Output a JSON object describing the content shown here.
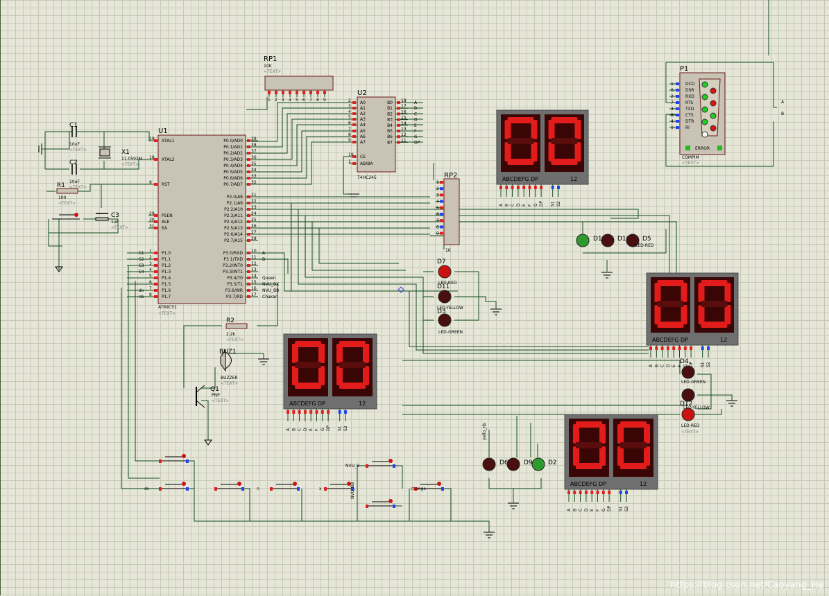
{
  "labels": {
    "u1_ref": "U1",
    "u1_part": "AT89C51",
    "u2_ref": "U2",
    "u2_part": "74HC245",
    "rp1_ref": "RP1",
    "rp1_val": "10K",
    "rp2_ref": "RP2",
    "rp2_val": "1K",
    "p1_ref": "P1",
    "p1_part": "COMPIM",
    "p1_error": "ERROR",
    "c1_ref": "C1",
    "c1_val": "10uF",
    "c2_ref": "C2",
    "c2_val": "10uF",
    "c3_ref": "C3",
    "c3_val": "1uF",
    "x1_ref": "X1",
    "x1_val": "11.0592M",
    "r1_ref": "R1",
    "r1_val": "100",
    "r2_ref": "R2",
    "r2_val": "2.2k",
    "buz_ref": "BUZ1",
    "buz_part": "BUZZER",
    "q1_ref": "Q1",
    "q1_part": "PNP",
    "text_tag": "<TEXT>",
    "disp_pins": "ABCDEFG  DP",
    "disp_digits": "12",
    "u1_xtal1": "XTAL1",
    "u1_xtal2": "XTAL2",
    "u1_rst": "RST",
    "u1_psen": "PSEN",
    "u1_ale": "ALE",
    "u1_ea": "EA",
    "led_red": "LED-RED",
    "led_yellow": "LED-YELLOW",
    "led_green": "LED-GREEN",
    "d1": "D1",
    "d2": "D2",
    "d3": "D3",
    "d4": "D4",
    "d5": "D5",
    "d6": "D6",
    "d7": "D7",
    "d8": "D8",
    "d9": "D9",
    "d10": "D10",
    "d11": "D11",
    "d12": "D12",
    "yello_nb": "yello_nb",
    "sw_sk": "sk",
    "sw_n": "n",
    "sw_x": "x",
    "sw_c": "c",
    "sw_nvu_b": "NVU_B",
    "sw_nvu_bb": "NVU_BB",
    "sw_change": "change",
    "seg_value": "00",
    "watermark": "https://blog.csdn.net/Caoyang_He"
  },
  "u1_left_pins": [
    {
      "num": "19",
      "name": "XTAL1"
    },
    {
      "num": "18",
      "name": "XTAL2"
    },
    {
      "num": "9",
      "name": "RST"
    },
    {
      "num": "29",
      "name": "PSEN"
    },
    {
      "num": "30",
      "name": "ALE"
    },
    {
      "num": "31",
      "name": "EA"
    },
    {
      "num": "1",
      "name": "P1.0"
    },
    {
      "num": "2",
      "name": "P1.1"
    },
    {
      "num": "3",
      "name": "P1.2"
    },
    {
      "num": "4",
      "name": "P1.3"
    },
    {
      "num": "5",
      "name": "P1.4"
    },
    {
      "num": "6",
      "name": "P1.5"
    },
    {
      "num": "7",
      "name": "P1.6"
    },
    {
      "num": "8",
      "name": "P1.7"
    }
  ],
  "u1_p1_nets": [
    "S1",
    "S2",
    "S3",
    "S4",
    "",
    "",
    "dx",
    "nb"
  ],
  "u1_right_pins": [
    {
      "num": "39",
      "name": "P0.0/AD0"
    },
    {
      "num": "38",
      "name": "P0.1/AD1"
    },
    {
      "num": "37",
      "name": "P0.2/AD2"
    },
    {
      "num": "36",
      "name": "P0.3/AD3"
    },
    {
      "num": "35",
      "name": "P0.4/AD4"
    },
    {
      "num": "34",
      "name": "P0.5/AD5"
    },
    {
      "num": "33",
      "name": "P0.6/AD6"
    },
    {
      "num": "32",
      "name": "P0.7/AD7"
    },
    {
      "num": "21",
      "name": "P2.0/A8"
    },
    {
      "num": "22",
      "name": "P2.1/A9"
    },
    {
      "num": "23",
      "name": "P2.2/A10"
    },
    {
      "num": "24",
      "name": "P2.3/A11"
    },
    {
      "num": "25",
      "name": "P2.4/A12"
    },
    {
      "num": "26",
      "name": "P2.5/A13"
    },
    {
      "num": "27",
      "name": "P2.6/A14"
    },
    {
      "num": "28",
      "name": "P2.7/A15"
    },
    {
      "num": "10",
      "name": "P3.0/RXD"
    },
    {
      "num": "11",
      "name": "P3.1/TXD"
    },
    {
      "num": "12",
      "name": "P3.2/INT0"
    },
    {
      "num": "13",
      "name": "P3.3/INT1"
    },
    {
      "num": "14",
      "name": "P3.4/T0"
    },
    {
      "num": "15",
      "name": "P3.5/T1"
    },
    {
      "num": "16",
      "name": "P3.6/WR"
    },
    {
      "num": "17",
      "name": "P3.7/RD"
    }
  ],
  "u1_p3_nets": [
    "A",
    "B",
    "",
    "",
    "Queen",
    "NVU_BX",
    "NVU_BB",
    "Chakan"
  ],
  "u2_left_pins": [
    {
      "num": "2",
      "name": "A0"
    },
    {
      "num": "3",
      "name": "A1"
    },
    {
      "num": "4",
      "name": "A2"
    },
    {
      "num": "5",
      "name": "A3"
    },
    {
      "num": "6",
      "name": "A4"
    },
    {
      "num": "7",
      "name": "A5"
    },
    {
      "num": "8",
      "name": "A6"
    },
    {
      "num": "9",
      "name": "A7"
    },
    {
      "num": "19",
      "name": "CE"
    },
    {
      "num": "1",
      "name": "AB/BA"
    }
  ],
  "u2_right_pins": [
    {
      "num": "18",
      "name": "B0",
      "net": "A"
    },
    {
      "num": "17",
      "name": "B1",
      "net": "B"
    },
    {
      "num": "16",
      "name": "B2",
      "net": "C"
    },
    {
      "num": "15",
      "name": "B3",
      "net": "D"
    },
    {
      "num": "14",
      "name": "B4",
      "net": "E"
    },
    {
      "num": "13",
      "name": "B5",
      "net": "F"
    },
    {
      "num": "12",
      "name": "B6",
      "net": "G"
    },
    {
      "num": "11",
      "name": "B7",
      "net": "DP"
    }
  ],
  "p1_pins": [
    {
      "num": "1",
      "name": "DCD"
    },
    {
      "num": "6",
      "name": "DSR"
    },
    {
      "num": "2",
      "name": "RXD"
    },
    {
      "num": "7",
      "name": "RTS"
    },
    {
      "num": "3",
      "name": "TXD"
    },
    {
      "num": "8",
      "name": "CTS"
    },
    {
      "num": "4",
      "name": "DTR"
    },
    {
      "num": "9",
      "name": "RI"
    }
  ],
  "rp2_pins": [
    "1",
    "2",
    "3",
    "4",
    "5",
    "6",
    "7",
    "8",
    "9"
  ],
  "display_bottom_labels": [
    "A",
    "B",
    "C",
    "D",
    "E",
    "F",
    "G",
    "DP",
    "",
    "S1",
    "S2"
  ],
  "colors": {
    "grid_bg": "#e5e6d8",
    "grid_line": "#c7c9b6",
    "wire": "#114d1c",
    "chip_body": "#c8c3b4",
    "chip_border": "#6b1b1b",
    "seg_on": "#e21b1b",
    "seg_bg": "#3a0505",
    "disp_frame": "#6f6f6f",
    "pin_red": "#e02020",
    "pin_blue": "#2244ee",
    "led_red": "#cc1111",
    "led_off": "#4a1010",
    "led_green": "#2e9a2e"
  }
}
